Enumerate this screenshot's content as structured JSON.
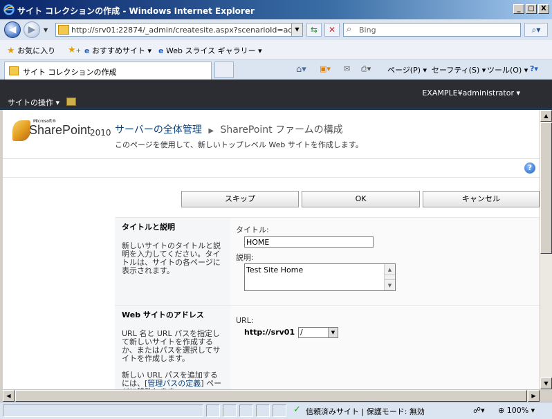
{
  "window": {
    "title": "サイト コレクションの作成 - Windows Internet Explorer",
    "controls": [
      "_",
      "□",
      "X"
    ]
  },
  "address": {
    "url": "http://srv01:22874/_admin/createsite.aspx?scenarioId=adminc",
    "search_placeholder": "Bing"
  },
  "favorites": {
    "label": "お気に入り",
    "items": [
      "おすすめサイト ▾",
      "Web スライス ギャラリー ▾"
    ]
  },
  "tab": {
    "label": "サイト コレクションの作成"
  },
  "commands": {
    "page": "ページ(P) ▾",
    "safety": "セーフティ(S) ▾",
    "tools": "ツール(O) ▾"
  },
  "sharepoint": {
    "user": "EXAMPLE¥administrator",
    "user_caret": "▾",
    "site_actions": "サイトの操作 ▾",
    "logo_ms": "Microsoft®",
    "logo_text": "SharePoint",
    "logo_year": "2010",
    "breadcrumb_root": "サーバーの全体管理",
    "breadcrumb_sep": "▶",
    "breadcrumb_current": "SharePoint ファームの構成",
    "page_description": "このページを使用して、新しいトップレベル Web サイトを作成します。"
  },
  "buttons": {
    "skip": "スキップ",
    "ok": "OK",
    "cancel": "キャンセル"
  },
  "section_title": {
    "heading": "タイトルと説明",
    "description": "新しいサイトのタイトルと説明を入力してください。タイトルは、サイトの各ページに表示されます。",
    "title_label": "タイトル:",
    "title_value": "HOME",
    "desc_label": "説明:",
    "desc_value": "Test Site Home"
  },
  "section_url": {
    "heading": "Web サイトのアドレス",
    "description1": "URL 名と URL パスを指定して新しいサイトを作成するか、またはパスを選択してサイトを作成します。",
    "description2_pre": "新しい URL パスを追加するには、[",
    "description2_link": "管理パスの定義",
    "description2_post": "] ページに移動します。",
    "url_label": "URL:",
    "url_prefix": "http://srv01",
    "path_value": "/"
  },
  "statusbar": {
    "status": "信頼済みサイト | 保護モード: 無効",
    "zoom": "100%"
  },
  "colors": {
    "titlebar": "#0a246a",
    "ribbon": "#2b2d33",
    "link": "#0b3f78"
  }
}
